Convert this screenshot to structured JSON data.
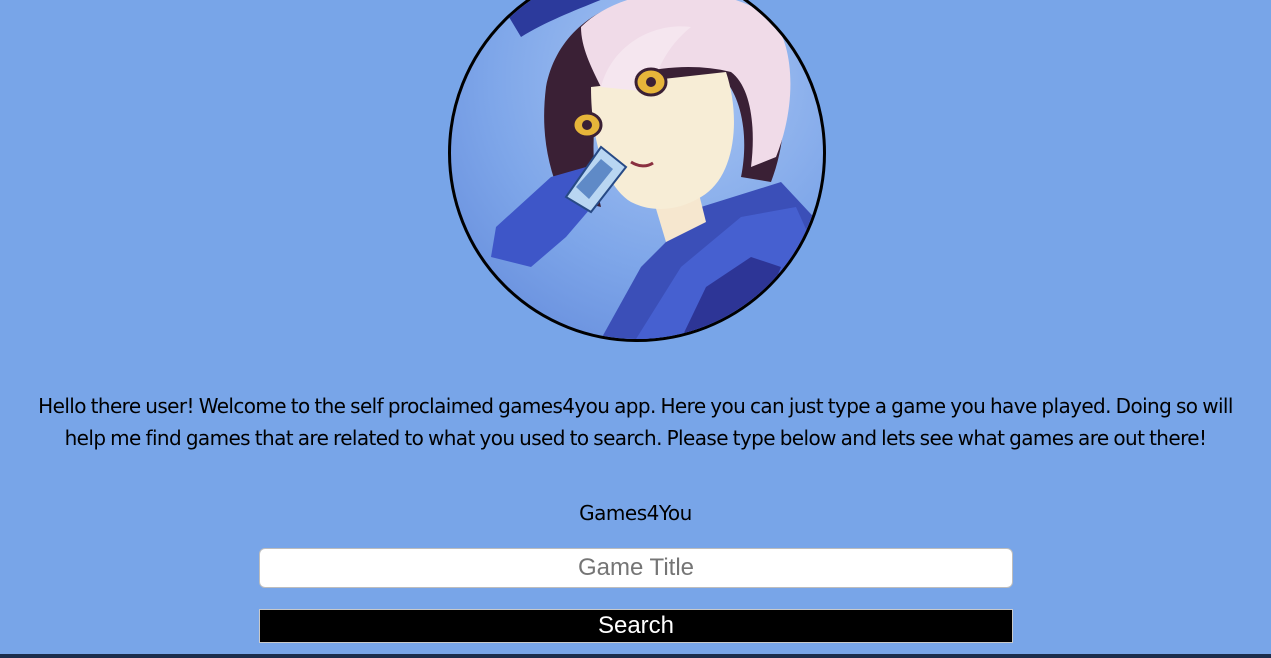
{
  "intro": {
    "line1": "Hello there user! Welcome to the self proclaimed games4you app. Here you can just type a game you have played. Doing so will",
    "line2": "help me find games that are related to what you used to search. Please type below and lets see what games are out there!"
  },
  "app": {
    "title": "Games4You"
  },
  "search": {
    "placeholder": "Game Title",
    "value": "",
    "button_label": "Search"
  },
  "colors": {
    "page_background": "#78a5e8",
    "button_background": "#000000",
    "button_text": "#ffffff"
  },
  "icons": {
    "avatar": "character-portrait"
  }
}
